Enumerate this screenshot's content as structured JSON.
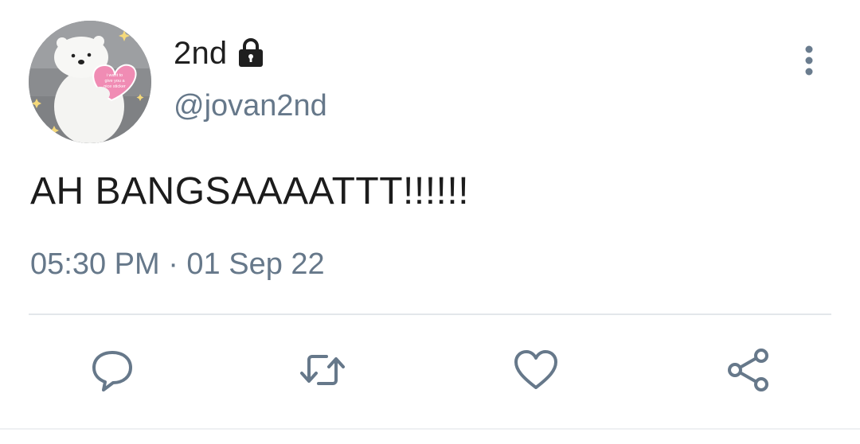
{
  "user": {
    "display_name": "2nd",
    "handle": "@jovan2nd",
    "verified_icon": "lock-icon",
    "avatar_icon": "polar-bear-holding-heart-avatar"
  },
  "tweet": {
    "text": "AH BANGSAAAATTT!!!!!!",
    "timestamp": "05:30 PM · 01 Sep 22"
  },
  "actions": [
    {
      "name": "reply",
      "icon": "speech-bubble-icon"
    },
    {
      "name": "retweet",
      "icon": "retweet-icon"
    },
    {
      "name": "like",
      "icon": "heart-icon"
    },
    {
      "name": "share",
      "icon": "share-icon"
    }
  ],
  "colors": {
    "text_primary": "#1c1c1c",
    "text_secondary": "#66788a",
    "divider": "#e3e7ea",
    "avatar_heart": "#f08cb4"
  }
}
